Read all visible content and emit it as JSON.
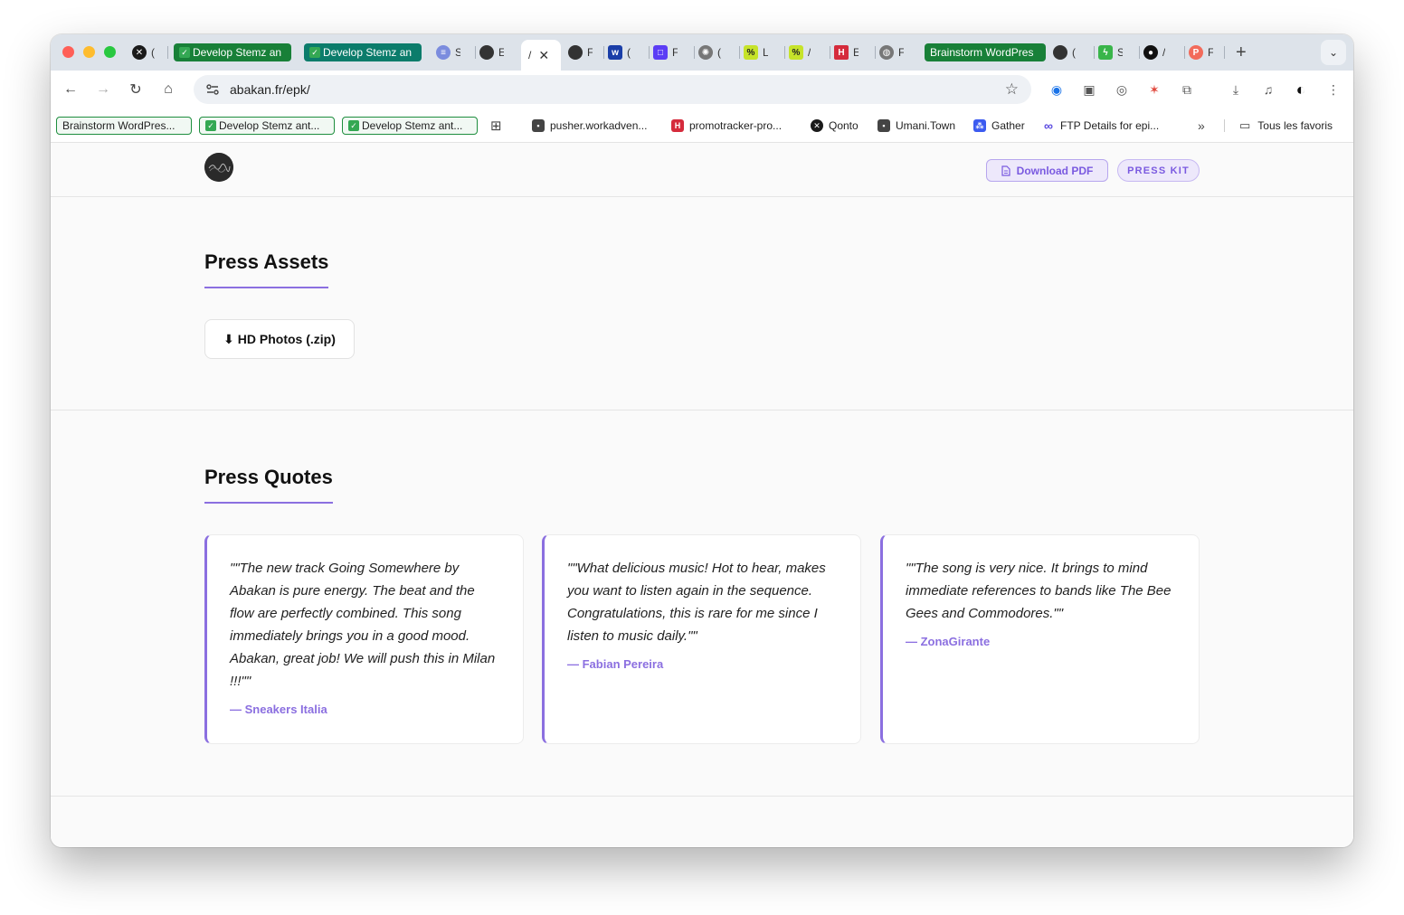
{
  "browser": {
    "tabs": [
      {
        "type": "icon",
        "icon": "x-circle-icon",
        "label": "(",
        "color": "#1a1a1a"
      },
      {
        "type": "pill",
        "label": "Develop Stemz an",
        "style": "green"
      },
      {
        "type": "pill",
        "label": "Develop Stemz an",
        "style": "teal"
      },
      {
        "type": "icon",
        "icon": "stack-icon",
        "label": "S",
        "color": "#7b8cde"
      },
      {
        "type": "icon",
        "icon": "dark-circle-icon",
        "label": "E",
        "color": "#333333"
      },
      {
        "type": "active",
        "label": "/"
      },
      {
        "type": "icon",
        "icon": "dark-circle-icon",
        "label": "F",
        "color": "#333333"
      },
      {
        "type": "icon",
        "icon": "wave-icon",
        "label": "(",
        "color": "#1a3ea8"
      },
      {
        "type": "icon",
        "icon": "square-icon",
        "label": "F",
        "color": "#5b3df5"
      },
      {
        "type": "icon",
        "icon": "openai-icon",
        "label": "(",
        "color": "#555555"
      },
      {
        "type": "icon",
        "icon": "lime-icon",
        "label": "L",
        "color": "#c6e32a"
      },
      {
        "type": "icon",
        "icon": "lime-icon",
        "label": "/",
        "color": "#c6e32a"
      },
      {
        "type": "icon",
        "icon": "h-icon",
        "label": "E",
        "color": "#d52b3c"
      },
      {
        "type": "icon",
        "icon": "globe-icon",
        "label": "F",
        "color": "#666666"
      },
      {
        "type": "pill",
        "label": "Brainstorm WordPres",
        "style": "green"
      },
      {
        "type": "icon",
        "icon": "dark-circle-icon",
        "label": "(",
        "color": "#333333"
      },
      {
        "type": "icon",
        "icon": "bolt-icon",
        "label": "S",
        "color": "#39b54a"
      },
      {
        "type": "icon",
        "icon": "github-icon",
        "label": "/",
        "color": "#111111"
      },
      {
        "type": "icon",
        "icon": "p-icon",
        "label": "F",
        "color": "#f26b5b"
      }
    ],
    "url": "abakan.fr/epk/",
    "bookmarks": [
      {
        "label": "Brainstorm WordPres...",
        "boxed": true
      },
      {
        "label": "Develop Stemz ant...",
        "boxed": true,
        "check": true
      },
      {
        "label": "Develop Stemz ant...",
        "boxed": true,
        "check": true
      },
      {
        "label": "pusher.workadven...",
        "icon": "page-icon"
      },
      {
        "label": "promotracker-pro...",
        "icon": "h-icon"
      },
      {
        "label": "Qonto",
        "icon": "x-circle-icon"
      },
      {
        "label": "Umani.Town",
        "icon": "page-icon"
      },
      {
        "label": "Gather",
        "icon": "gather-icon"
      },
      {
        "label": "FTP Details for epi...",
        "icon": "infinity-icon"
      }
    ],
    "all_bookmarks_label": "Tous les favoris",
    "more_bookmarks": "»"
  },
  "site": {
    "download_pdf_label": "Download PDF",
    "press_kit_label": "PRESS KIT"
  },
  "press_assets": {
    "title": "Press Assets",
    "download_label": "⬇ HD Photos (.zip)"
  },
  "press_quotes": {
    "title": "Press Quotes",
    "quotes": [
      {
        "text": "\"\"The new track Going Somewhere by Abakan is pure energy. The beat and the flow are perfectly combined. This song immediately brings you in a good mood. Abakan, great job! We will push this in Milan !!!\"\"",
        "author": "— Sneakers Italia"
      },
      {
        "text": "\"\"What delicious music! Hot to hear, makes you want to listen again in the sequence. Congratulations, this is rare for me since I listen to music daily.\"\"",
        "author": "— Fabian Pereira"
      },
      {
        "text": "\"\"The song is very nice. It brings to mind immediate references to bands like The Bee Gees and Commodores.\"\"",
        "author": "— ZonaGirante"
      }
    ]
  },
  "colors": {
    "accent": "#8b6fe0",
    "tab_green": "#188038",
    "tab_teal": "#0b7c6b"
  }
}
